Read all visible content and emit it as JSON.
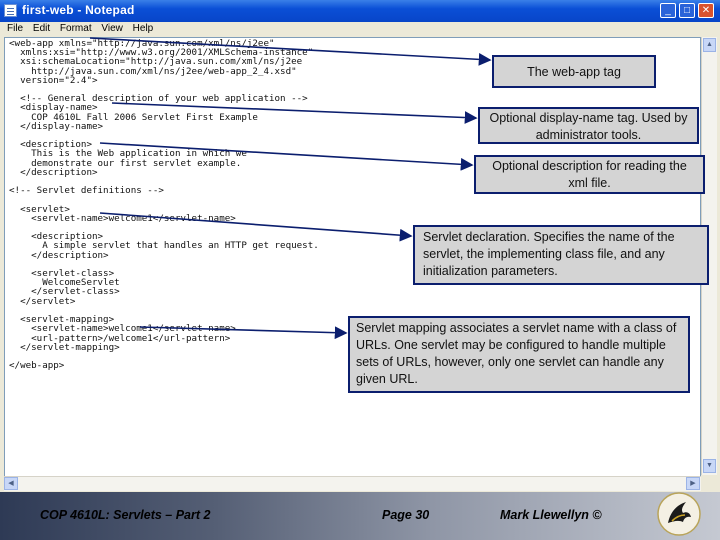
{
  "window": {
    "title": "first-web - Notepad",
    "minimize_icon": "_",
    "maximize_icon": "□",
    "close_icon": "✕"
  },
  "menu": [
    "File",
    "Edit",
    "Format",
    "View",
    "Help"
  ],
  "code_text": "<web-app xmlns=\"http://java.sun.com/xml/ns/j2ee\"\n  xmlns:xsi=\"http://www.w3.org/2001/XMLSchema-instance\"\n  xsi:schemaLocation=\"http://java.sun.com/xml/ns/j2ee\n    http://java.sun.com/xml/ns/j2ee/web-app_2_4.xsd\"\n  version=\"2.4\">\n\n  <!-- General description of your web application -->\n  <display-name>\n    COP 4610L Fall 2006 Servlet First Example\n  </display-name>\n\n  <description>\n    This is the Web application in which we\n    demonstrate our first servlet example.\n  </description>\n\n<!-- Servlet definitions -->\n\n  <servlet>\n    <servlet-name>welcome1</servlet-name>\n\n    <description>\n      A simple servlet that handles an HTTP get request.\n    </description>\n\n    <servlet-class>\n      WelcomeServlet\n    </servlet-class>\n  </servlet>\n\n  <servlet-mapping>\n    <servlet-name>welcome1</servlet-name>\n    <url-pattern>/welcome1</url-pattern>\n  </servlet-mapping>\n\n</web-app>",
  "callouts": {
    "web_app": "The web-app tag",
    "display_name": "Optional display-name tag. Used by administrator tools.",
    "description": "Optional description for reading the xml file.",
    "servlet": "Servlet declaration.  Specifies the name of the servlet, the implementing class file, and any initialization parameters.",
    "mapping": "Servlet mapping associates a servlet name with a class of URLs.  One servlet may be configured to handle multiple sets of URLs, however, only one servlet can handle any given URL."
  },
  "footer": {
    "course": "COP 4610L: Servlets – Part 2",
    "page": "Page 30",
    "author": "Mark Llewellyn ©"
  },
  "colors": {
    "titlebar": "#0a4fd6",
    "callout_fill": "#d4d4d4",
    "callout_border": "#0b1e6e",
    "arrow": "#0b1e6e"
  }
}
